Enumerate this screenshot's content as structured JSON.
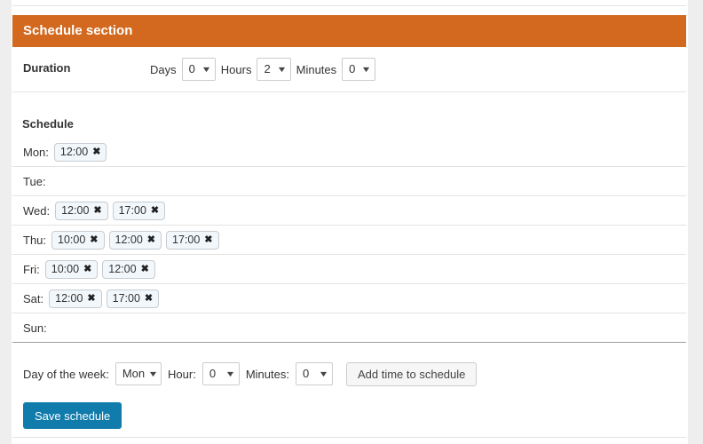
{
  "section": {
    "title": "Schedule section"
  },
  "duration": {
    "label": "Duration",
    "days_label": "Days",
    "days_value": "0",
    "hours_label": "Hours",
    "hours_value": "2",
    "minutes_label": "Minutes",
    "minutes_value": "0",
    "caret": "▼"
  },
  "schedule": {
    "title": "Schedule",
    "remove_icon": "✖",
    "days": [
      {
        "name": "Mon:",
        "times": [
          "12:00"
        ]
      },
      {
        "name": "Tue:",
        "times": []
      },
      {
        "name": "Wed:",
        "times": [
          "12:00",
          "17:00"
        ]
      },
      {
        "name": "Thu:",
        "times": [
          "10:00",
          "12:00",
          "17:00"
        ]
      },
      {
        "name": "Fri:",
        "times": [
          "10:00",
          "12:00"
        ]
      },
      {
        "name": "Sat:",
        "times": [
          "12:00",
          "17:00"
        ]
      },
      {
        "name": "Sun:",
        "times": []
      }
    ]
  },
  "add_time": {
    "day_label": "Day of the week:",
    "day_value": "Mon",
    "hour_label": "Hour:",
    "hour_value": "0",
    "minutes_label": "Minutes:",
    "minutes_value": "0",
    "button_label": "Add time to schedule",
    "caret": "▼"
  },
  "save": {
    "label": "Save schedule"
  },
  "colors": {
    "header_orange": "#d2691e",
    "primary_blue": "#117cac",
    "tag_background": "#f2f7fb",
    "divider": "#e3e3e3"
  }
}
